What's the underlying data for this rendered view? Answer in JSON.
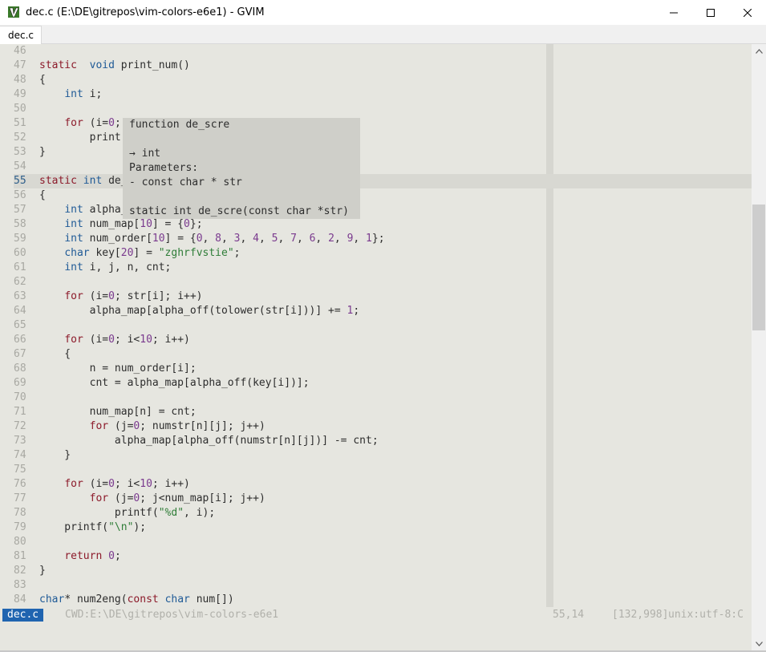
{
  "window": {
    "title": "dec.c (E:\\DE\\gitrepos\\vim-colors-e6e1) - GVIM"
  },
  "tabs": [
    {
      "label": "dec.c"
    }
  ],
  "popup": {
    "lines": [
      "function de_scre",
      "",
      "→ int",
      "Parameters:",
      "- const char * str",
      "",
      "static int de_scre(const char *str)"
    ]
  },
  "code": {
    "lines": [
      {
        "n": "46",
        "tokens": []
      },
      {
        "n": "47",
        "tokens": [
          [
            "kw",
            "static"
          ],
          [
            "",
            "  "
          ],
          [
            "ty",
            "void"
          ],
          [
            "",
            " print_num()"
          ]
        ]
      },
      {
        "n": "48",
        "tokens": [
          [
            "",
            "{"
          ]
        ]
      },
      {
        "n": "49",
        "tokens": [
          [
            "",
            "    "
          ],
          [
            "ty",
            "int"
          ],
          [
            "",
            " i;"
          ]
        ]
      },
      {
        "n": "50",
        "tokens": []
      },
      {
        "n": "51",
        "tokens": [
          [
            "",
            "    "
          ],
          [
            "kw",
            "for"
          ],
          [
            "",
            " (i="
          ],
          [
            "num",
            "0"
          ],
          [
            "",
            ";"
          ]
        ]
      },
      {
        "n": "52",
        "tokens": [
          [
            "",
            "        print"
          ]
        ]
      },
      {
        "n": "53",
        "tokens": [
          [
            "",
            "}"
          ]
        ]
      },
      {
        "n": "54",
        "tokens": []
      },
      {
        "n": "55",
        "tokens": [
          [
            "kw",
            "static"
          ],
          [
            "",
            " "
          ],
          [
            "ty",
            "int"
          ],
          [
            "",
            " de_scre("
          ],
          [
            "kw",
            "const"
          ],
          [
            "",
            " "
          ],
          [
            "ty",
            "char"
          ],
          [
            "",
            "* str)"
          ]
        ],
        "current": true
      },
      {
        "n": "56",
        "tokens": [
          [
            "",
            "{"
          ]
        ]
      },
      {
        "n": "57",
        "tokens": [
          [
            "",
            "    "
          ],
          [
            "ty",
            "int"
          ],
          [
            "",
            " alpha_map[ALPHA_MAP_LEN] = {"
          ],
          [
            "num",
            "0"
          ],
          [
            "",
            "};"
          ]
        ]
      },
      {
        "n": "58",
        "tokens": [
          [
            "",
            "    "
          ],
          [
            "ty",
            "int"
          ],
          [
            "",
            " num_map["
          ],
          [
            "num",
            "10"
          ],
          [
            "",
            "] = {"
          ],
          [
            "num",
            "0"
          ],
          [
            "",
            "};"
          ]
        ]
      },
      {
        "n": "59",
        "tokens": [
          [
            "",
            "    "
          ],
          [
            "ty",
            "int"
          ],
          [
            "",
            " num_order["
          ],
          [
            "num",
            "10"
          ],
          [
            "",
            "] = {"
          ],
          [
            "num",
            "0"
          ],
          [
            ", ",
            ""
          ],
          [
            "",
            ", "
          ],
          [
            "num",
            "8"
          ],
          [
            "",
            ", "
          ],
          [
            "num",
            "3"
          ],
          [
            "",
            ", "
          ],
          [
            "num",
            "4"
          ],
          [
            "",
            ", "
          ],
          [
            "num",
            "5"
          ],
          [
            "",
            ", "
          ],
          [
            "num",
            "7"
          ],
          [
            "",
            ", "
          ],
          [
            "num",
            "6"
          ],
          [
            "",
            ", "
          ],
          [
            "num",
            "2"
          ],
          [
            "",
            ", "
          ],
          [
            "num",
            "9"
          ],
          [
            "",
            ", "
          ],
          [
            "num",
            "1"
          ],
          [
            "",
            "};"
          ]
        ]
      },
      {
        "n": "60",
        "tokens": [
          [
            "",
            "    "
          ],
          [
            "ty",
            "char"
          ],
          [
            "",
            " key["
          ],
          [
            "num",
            "20"
          ],
          [
            "",
            "] = "
          ],
          [
            "str",
            "\"zghrfvstie\""
          ],
          [
            "",
            ";"
          ]
        ]
      },
      {
        "n": "61",
        "tokens": [
          [
            "",
            "    "
          ],
          [
            "ty",
            "int"
          ],
          [
            "",
            " i, j, n, cnt;"
          ]
        ]
      },
      {
        "n": "62",
        "tokens": []
      },
      {
        "n": "63",
        "tokens": [
          [
            "",
            "    "
          ],
          [
            "kw",
            "for"
          ],
          [
            "",
            " (i="
          ],
          [
            "num",
            "0"
          ],
          [
            "",
            "; str[i]; i++)"
          ]
        ]
      },
      {
        "n": "64",
        "tokens": [
          [
            "",
            "        alpha_map[alpha_off(tolower(str[i]))] += "
          ],
          [
            "num",
            "1"
          ],
          [
            "",
            ";"
          ]
        ]
      },
      {
        "n": "65",
        "tokens": []
      },
      {
        "n": "66",
        "tokens": [
          [
            "",
            "    "
          ],
          [
            "kw",
            "for"
          ],
          [
            "",
            " (i="
          ],
          [
            "num",
            "0"
          ],
          [
            "",
            "; i<"
          ],
          [
            "num",
            "10"
          ],
          [
            "",
            "; i++)"
          ]
        ]
      },
      {
        "n": "67",
        "tokens": [
          [
            "",
            "    {"
          ]
        ]
      },
      {
        "n": "68",
        "tokens": [
          [
            "",
            "        n = num_order[i];"
          ]
        ]
      },
      {
        "n": "69",
        "tokens": [
          [
            "",
            "        cnt = alpha_map[alpha_off(key[i])];"
          ]
        ]
      },
      {
        "n": "70",
        "tokens": []
      },
      {
        "n": "71",
        "tokens": [
          [
            "",
            "        num_map[n] = cnt;"
          ]
        ]
      },
      {
        "n": "72",
        "tokens": [
          [
            "",
            "        "
          ],
          [
            "kw",
            "for"
          ],
          [
            "",
            " (j="
          ],
          [
            "num",
            "0"
          ],
          [
            "",
            "; numstr[n][j]; j++)"
          ]
        ]
      },
      {
        "n": "73",
        "tokens": [
          [
            "",
            "            alpha_map[alpha_off(numstr[n][j])] -= cnt;"
          ]
        ]
      },
      {
        "n": "74",
        "tokens": [
          [
            "",
            "    }"
          ]
        ]
      },
      {
        "n": "75",
        "tokens": []
      },
      {
        "n": "76",
        "tokens": [
          [
            "",
            "    "
          ],
          [
            "kw",
            "for"
          ],
          [
            "",
            " (i="
          ],
          [
            "num",
            "0"
          ],
          [
            "",
            "; i<"
          ],
          [
            "num",
            "10"
          ],
          [
            "",
            "; i++)"
          ]
        ]
      },
      {
        "n": "77",
        "tokens": [
          [
            "",
            "        "
          ],
          [
            "kw",
            "for"
          ],
          [
            "",
            " (j="
          ],
          [
            "num",
            "0"
          ],
          [
            "",
            "; j<num_map[i]; j++)"
          ]
        ]
      },
      {
        "n": "78",
        "tokens": [
          [
            "",
            "            printf("
          ],
          [
            "str",
            "\"%d\""
          ],
          [
            "",
            ", i);"
          ]
        ]
      },
      {
        "n": "79",
        "tokens": [
          [
            "",
            "    printf("
          ],
          [
            "str",
            "\"\\n\""
          ],
          [
            "",
            ");"
          ]
        ]
      },
      {
        "n": "80",
        "tokens": []
      },
      {
        "n": "81",
        "tokens": [
          [
            "",
            "    "
          ],
          [
            "kw",
            "return"
          ],
          [
            "",
            " "
          ],
          [
            "num",
            "0"
          ],
          [
            "",
            ";"
          ]
        ]
      },
      {
        "n": "82",
        "tokens": [
          [
            "",
            "}"
          ]
        ]
      },
      {
        "n": "83",
        "tokens": []
      },
      {
        "n": "84",
        "tokens": [
          [
            "ty",
            "char"
          ],
          [
            "",
            "* num2eng("
          ],
          [
            "kw",
            "const"
          ],
          [
            "",
            " "
          ],
          [
            "ty",
            "char"
          ],
          [
            "",
            " num[])"
          ]
        ]
      }
    ]
  },
  "statusline": {
    "file": "dec.c",
    "cwd": "CWD:E:\\DE\\gitrepos\\vim-colors-e6e1",
    "position": "55,14",
    "count": "[132,998]",
    "encoding": "unix:utf-8:C"
  },
  "colors": {
    "background": "#e6e6e0",
    "keyword": "#8c1a2a",
    "type": "#1f5a96",
    "number": "#7a3a8e",
    "string": "#2f7d38",
    "statusfile": "#1f64b0"
  }
}
